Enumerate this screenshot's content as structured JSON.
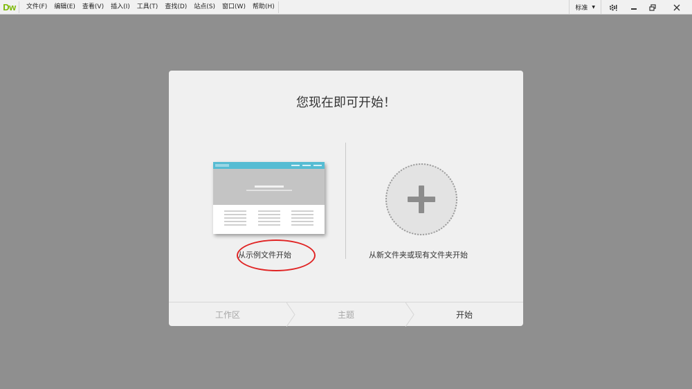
{
  "app": {
    "logo_text": "Dw",
    "brand_color": "#7ab800"
  },
  "menu": {
    "items": [
      "文件(F)",
      "编辑(E)",
      "查看(V)",
      "插入(I)",
      "工具(T)",
      "查找(D)",
      "站点(S)",
      "窗口(W)",
      "帮助(H)"
    ]
  },
  "toolbar": {
    "workspace_label": "标准",
    "gear_icon": "gear-icon",
    "window_buttons": [
      "minimize-icon",
      "restore-icon",
      "close-icon"
    ]
  },
  "dialog": {
    "title": "您现在即可开始！",
    "option_sample": {
      "label": "从示例文件开始",
      "icon": "sample-page-thumbnail"
    },
    "option_folder": {
      "label": "从新文件夹或现有文件夹开始",
      "icon": "plus-icon"
    },
    "steps": [
      "工作区",
      "主题",
      "开始"
    ],
    "active_step": "开始",
    "highlight_color": "#e02424"
  }
}
